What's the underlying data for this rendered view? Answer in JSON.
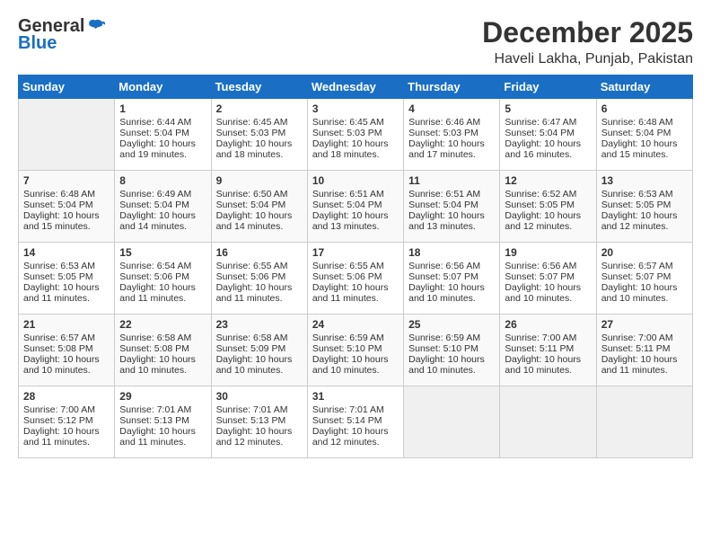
{
  "logo": {
    "general": "General",
    "blue": "Blue"
  },
  "title": "December 2025",
  "subtitle": "Haveli Lakha, Punjab, Pakistan",
  "days_header": [
    "Sunday",
    "Monday",
    "Tuesday",
    "Wednesday",
    "Thursday",
    "Friday",
    "Saturday"
  ],
  "weeks": [
    [
      {
        "day": "",
        "sunrise": "",
        "sunset": "",
        "daylight": "",
        "empty": true
      },
      {
        "day": "1",
        "sunrise": "Sunrise: 6:44 AM",
        "sunset": "Sunset: 5:04 PM",
        "daylight": "Daylight: 10 hours and 19 minutes."
      },
      {
        "day": "2",
        "sunrise": "Sunrise: 6:45 AM",
        "sunset": "Sunset: 5:03 PM",
        "daylight": "Daylight: 10 hours and 18 minutes."
      },
      {
        "day": "3",
        "sunrise": "Sunrise: 6:45 AM",
        "sunset": "Sunset: 5:03 PM",
        "daylight": "Daylight: 10 hours and 18 minutes."
      },
      {
        "day": "4",
        "sunrise": "Sunrise: 6:46 AM",
        "sunset": "Sunset: 5:03 PM",
        "daylight": "Daylight: 10 hours and 17 minutes."
      },
      {
        "day": "5",
        "sunrise": "Sunrise: 6:47 AM",
        "sunset": "Sunset: 5:04 PM",
        "daylight": "Daylight: 10 hours and 16 minutes."
      },
      {
        "day": "6",
        "sunrise": "Sunrise: 6:48 AM",
        "sunset": "Sunset: 5:04 PM",
        "daylight": "Daylight: 10 hours and 15 minutes."
      }
    ],
    [
      {
        "day": "7",
        "sunrise": "Sunrise: 6:48 AM",
        "sunset": "Sunset: 5:04 PM",
        "daylight": "Daylight: 10 hours and 15 minutes."
      },
      {
        "day": "8",
        "sunrise": "Sunrise: 6:49 AM",
        "sunset": "Sunset: 5:04 PM",
        "daylight": "Daylight: 10 hours and 14 minutes."
      },
      {
        "day": "9",
        "sunrise": "Sunrise: 6:50 AM",
        "sunset": "Sunset: 5:04 PM",
        "daylight": "Daylight: 10 hours and 14 minutes."
      },
      {
        "day": "10",
        "sunrise": "Sunrise: 6:51 AM",
        "sunset": "Sunset: 5:04 PM",
        "daylight": "Daylight: 10 hours and 13 minutes."
      },
      {
        "day": "11",
        "sunrise": "Sunrise: 6:51 AM",
        "sunset": "Sunset: 5:04 PM",
        "daylight": "Daylight: 10 hours and 13 minutes."
      },
      {
        "day": "12",
        "sunrise": "Sunrise: 6:52 AM",
        "sunset": "Sunset: 5:05 PM",
        "daylight": "Daylight: 10 hours and 12 minutes."
      },
      {
        "day": "13",
        "sunrise": "Sunrise: 6:53 AM",
        "sunset": "Sunset: 5:05 PM",
        "daylight": "Daylight: 10 hours and 12 minutes."
      }
    ],
    [
      {
        "day": "14",
        "sunrise": "Sunrise: 6:53 AM",
        "sunset": "Sunset: 5:05 PM",
        "daylight": "Daylight: 10 hours and 11 minutes."
      },
      {
        "day": "15",
        "sunrise": "Sunrise: 6:54 AM",
        "sunset": "Sunset: 5:06 PM",
        "daylight": "Daylight: 10 hours and 11 minutes."
      },
      {
        "day": "16",
        "sunrise": "Sunrise: 6:55 AM",
        "sunset": "Sunset: 5:06 PM",
        "daylight": "Daylight: 10 hours and 11 minutes."
      },
      {
        "day": "17",
        "sunrise": "Sunrise: 6:55 AM",
        "sunset": "Sunset: 5:06 PM",
        "daylight": "Daylight: 10 hours and 11 minutes."
      },
      {
        "day": "18",
        "sunrise": "Sunrise: 6:56 AM",
        "sunset": "Sunset: 5:07 PM",
        "daylight": "Daylight: 10 hours and 10 minutes."
      },
      {
        "day": "19",
        "sunrise": "Sunrise: 6:56 AM",
        "sunset": "Sunset: 5:07 PM",
        "daylight": "Daylight: 10 hours and 10 minutes."
      },
      {
        "day": "20",
        "sunrise": "Sunrise: 6:57 AM",
        "sunset": "Sunset: 5:07 PM",
        "daylight": "Daylight: 10 hours and 10 minutes."
      }
    ],
    [
      {
        "day": "21",
        "sunrise": "Sunrise: 6:57 AM",
        "sunset": "Sunset: 5:08 PM",
        "daylight": "Daylight: 10 hours and 10 minutes."
      },
      {
        "day": "22",
        "sunrise": "Sunrise: 6:58 AM",
        "sunset": "Sunset: 5:08 PM",
        "daylight": "Daylight: 10 hours and 10 minutes."
      },
      {
        "day": "23",
        "sunrise": "Sunrise: 6:58 AM",
        "sunset": "Sunset: 5:09 PM",
        "daylight": "Daylight: 10 hours and 10 minutes."
      },
      {
        "day": "24",
        "sunrise": "Sunrise: 6:59 AM",
        "sunset": "Sunset: 5:10 PM",
        "daylight": "Daylight: 10 hours and 10 minutes."
      },
      {
        "day": "25",
        "sunrise": "Sunrise: 6:59 AM",
        "sunset": "Sunset: 5:10 PM",
        "daylight": "Daylight: 10 hours and 10 minutes."
      },
      {
        "day": "26",
        "sunrise": "Sunrise: 7:00 AM",
        "sunset": "Sunset: 5:11 PM",
        "daylight": "Daylight: 10 hours and 10 minutes."
      },
      {
        "day": "27",
        "sunrise": "Sunrise: 7:00 AM",
        "sunset": "Sunset: 5:11 PM",
        "daylight": "Daylight: 10 hours and 11 minutes."
      }
    ],
    [
      {
        "day": "28",
        "sunrise": "Sunrise: 7:00 AM",
        "sunset": "Sunset: 5:12 PM",
        "daylight": "Daylight: 10 hours and 11 minutes."
      },
      {
        "day": "29",
        "sunrise": "Sunrise: 7:01 AM",
        "sunset": "Sunset: 5:13 PM",
        "daylight": "Daylight: 10 hours and 11 minutes."
      },
      {
        "day": "30",
        "sunrise": "Sunrise: 7:01 AM",
        "sunset": "Sunset: 5:13 PM",
        "daylight": "Daylight: 10 hours and 12 minutes."
      },
      {
        "day": "31",
        "sunrise": "Sunrise: 7:01 AM",
        "sunset": "Sunset: 5:14 PM",
        "daylight": "Daylight: 10 hours and 12 minutes."
      },
      {
        "day": "",
        "sunrise": "",
        "sunset": "",
        "daylight": "",
        "empty": true
      },
      {
        "day": "",
        "sunrise": "",
        "sunset": "",
        "daylight": "",
        "empty": true
      },
      {
        "day": "",
        "sunrise": "",
        "sunset": "",
        "daylight": "",
        "empty": true
      }
    ]
  ]
}
